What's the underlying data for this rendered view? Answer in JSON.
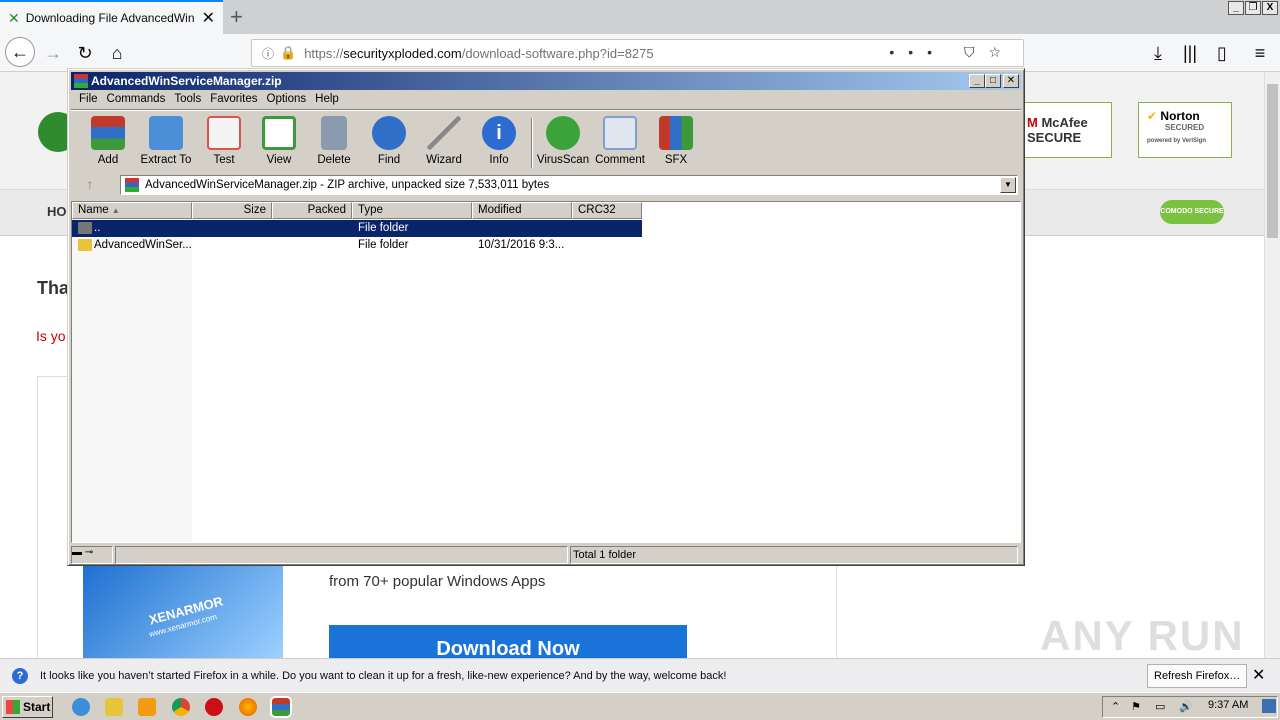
{
  "browser": {
    "tab_title": "Downloading File AdvancedWinSer",
    "url_domain": "securityxploded.com",
    "url_prefix": "https://",
    "url_path": "/download-software.php?id=8275",
    "overflow_icon": "•••"
  },
  "page": {
    "nav_first": "HO",
    "heading_partial": "Tha",
    "red_partial": "Is yo",
    "promo_text": "from 70+ popular Windows Apps",
    "download_button": "Download Now",
    "brand": "XENARMOR",
    "brand_url": "www.xenarmor.com",
    "badges": {
      "mcafee": "McAfee SECURE",
      "norton": "Norton",
      "norton_sub": "SECURED",
      "norton_powered": "powered by VeriSign",
      "comodo": "COMODO SECURE"
    }
  },
  "winrar": {
    "title": "AdvancedWinServiceManager.zip",
    "menus": [
      "File",
      "Commands",
      "Tools",
      "Favorites",
      "Options",
      "Help"
    ],
    "tools": [
      {
        "label": "Add",
        "icon": "archive-add-icon",
        "color": "#c0392b"
      },
      {
        "label": "Extract To",
        "icon": "extract-folder-icon",
        "color": "#4a8fd8"
      },
      {
        "label": "Test",
        "icon": "test-checklist-icon",
        "color": "#d9534f"
      },
      {
        "label": "View",
        "icon": "view-book-icon",
        "color": "#3c9a3c"
      },
      {
        "label": "Delete",
        "icon": "delete-bin-icon",
        "color": "#8a9bb0"
      },
      {
        "label": "Find",
        "icon": "find-magnifier-icon",
        "color": "#2f6fc7"
      },
      {
        "label": "Wizard",
        "icon": "wizard-wand-icon",
        "color": "#aaaaaa"
      },
      {
        "label": "Info",
        "icon": "info-icon",
        "color": "#2c6bd1"
      },
      {
        "label": "VirusScan",
        "icon": "virus-scan-icon",
        "color": "#3aa33a"
      },
      {
        "label": "Comment",
        "icon": "comment-icon",
        "color": "#7fa0c8"
      },
      {
        "label": "SFX",
        "icon": "sfx-archive-icon",
        "color": "#c0392b"
      }
    ],
    "path_text": "AdvancedWinServiceManager.zip - ZIP archive, unpacked size 7,533,011 bytes",
    "columns": [
      "Name",
      "Size",
      "Packed",
      "Type",
      "Modified",
      "CRC32"
    ],
    "rows": [
      {
        "name": "..",
        "size": "",
        "packed": "",
        "type": "File folder",
        "modified": "",
        "crc": ""
      },
      {
        "name": "AdvancedWinSer...",
        "size": "",
        "packed": "",
        "type": "File folder",
        "modified": "10/31/2016 9:3...",
        "crc": ""
      }
    ],
    "status_total": "Total 1 folder"
  },
  "notification": {
    "message": "It looks like you haven’t started Firefox in a while. Do you want to clean it up for a fresh, like-new experience? And by the way, welcome back!",
    "button": "Refresh Firefox…"
  },
  "taskbar": {
    "start": "Start",
    "clock": "9:37 AM"
  },
  "watermark": "ANY RUN"
}
